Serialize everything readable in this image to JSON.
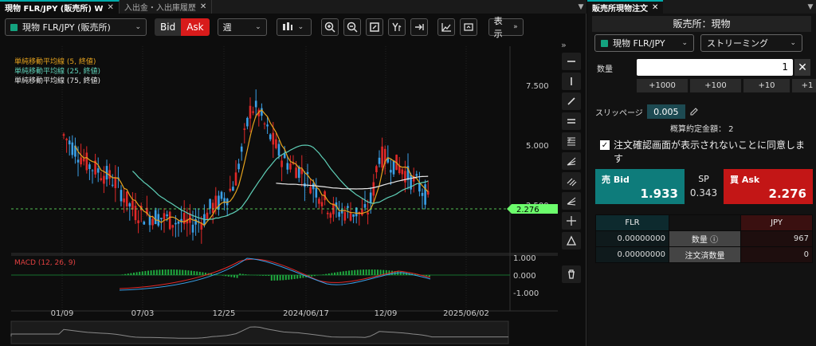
{
  "left_tabs": [
    {
      "label": "現物 FLR/JPY (販売所) W",
      "close": "✕"
    },
    {
      "label": "入出金・入出庫履歴",
      "close": "✕"
    }
  ],
  "toolbar": {
    "symbol": "現物 FLR/JPY (販売所)",
    "bid": "Bid",
    "ask": "Ask",
    "period": "週",
    "display": "表示"
  },
  "legend": [
    {
      "label": "単純移動平均線 (5, 終値)",
      "color": "#e6a31e"
    },
    {
      "label": "単純移動平均線 (25, 終値)",
      "color": "#5fd0b8"
    },
    {
      "label": "単純移動平均線 (75, 終値)",
      "color": "#e8e8e8"
    }
  ],
  "price_axis": [
    "7.500",
    "5.000",
    "2.500"
  ],
  "current_price": "2.276",
  "macd": {
    "label": "MACD (12, 26, 9)",
    "axis": [
      "1.000",
      "0.000",
      "-1.000"
    ]
  },
  "x_axis": [
    "01/09",
    "07/03",
    "12/25",
    "2024/06/17",
    "12/09",
    "2025/06/02"
  ],
  "right": {
    "tab": "販売所現物注文",
    "title": "販売所：現物",
    "symbol": "現物 FLR/JPY",
    "mode": "ストリーミング",
    "qty_label": "数量",
    "qty_value": "1",
    "qty_buttons": [
      "+1000",
      "+100",
      "+10",
      "+1"
    ],
    "slip_label": "スリッページ",
    "slip_value": "0.005",
    "estimate": "概算約定金額： 2",
    "confirm_text": "注文確認画面が表示されないことに同意します",
    "bid_label": "売 Bid",
    "bid_value": "1.933",
    "sp_label": "SP",
    "sp_value": "0.343",
    "ask_label": "買 Ask",
    "ask_value": "2.276",
    "table": {
      "left_head": "FLR",
      "right_head": "JPY",
      "rows": [
        {
          "left": "0.00000000",
          "mid": "数量 ⓘ",
          "right": "967"
        },
        {
          "left": "0.00000000",
          "mid": "注文済数量",
          "right": "0"
        }
      ]
    }
  },
  "colors": {
    "bull": "#e02828",
    "bear": "#3aa0e8",
    "price_marker": "#6cfc6c"
  }
}
